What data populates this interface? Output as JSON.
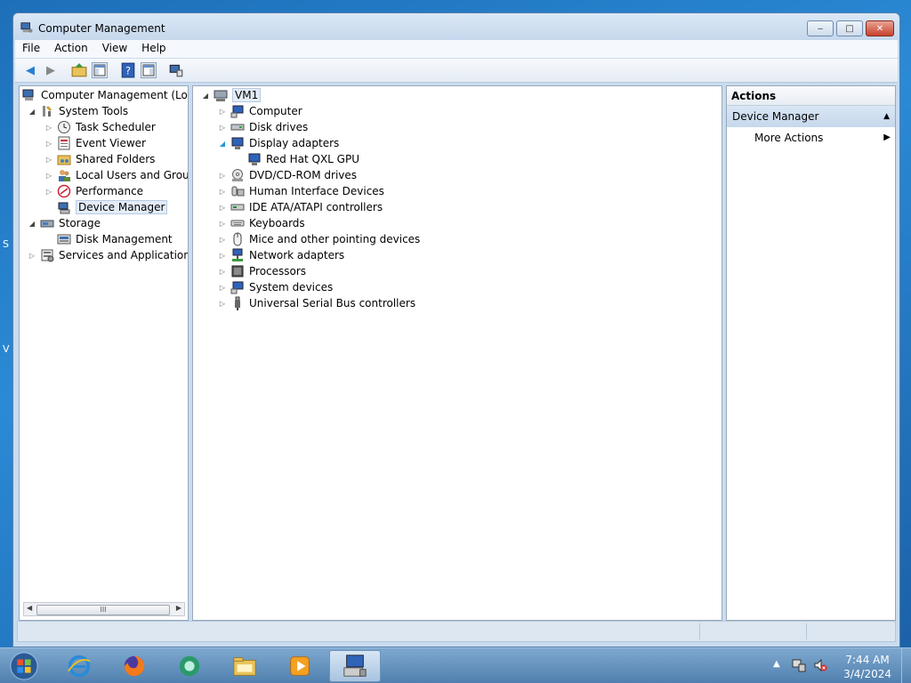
{
  "window": {
    "title": "Computer Management",
    "controls": {
      "minimize": "‒",
      "maximize": "□",
      "close": "✕"
    }
  },
  "menu": [
    "File",
    "Action",
    "View",
    "Help"
  ],
  "left_tree": {
    "root": "Computer Management (Local",
    "system_tools": "System Tools",
    "task_scheduler": "Task Scheduler",
    "event_viewer": "Event Viewer",
    "shared_folders": "Shared Folders",
    "local_users": "Local Users and Groups",
    "performance": "Performance",
    "device_manager": "Device Manager",
    "storage": "Storage",
    "disk_management": "Disk Management",
    "services": "Services and Applications",
    "scroll_grip": "III"
  },
  "device_tree": {
    "root": "VM1",
    "computer": "Computer",
    "disk_drives": "Disk drives",
    "display_adapters": "Display adapters",
    "gpu": "Red Hat QXL GPU",
    "dvd": "DVD/CD-ROM drives",
    "hid": "Human Interface Devices",
    "ide": "IDE ATA/ATAPI controllers",
    "keyboards": "Keyboards",
    "mice": "Mice and other pointing devices",
    "network": "Network adapters",
    "processors": "Processors",
    "system_devices": "System devices",
    "usb": "Universal Serial Bus controllers"
  },
  "actions_pane": {
    "header": "Actions",
    "section": "Device Manager",
    "more_actions": "More Actions"
  },
  "taskbar": {
    "time": "7:44 AM",
    "date": "3/4/2024"
  },
  "desktop_stubs": [
    "S",
    "V"
  ]
}
